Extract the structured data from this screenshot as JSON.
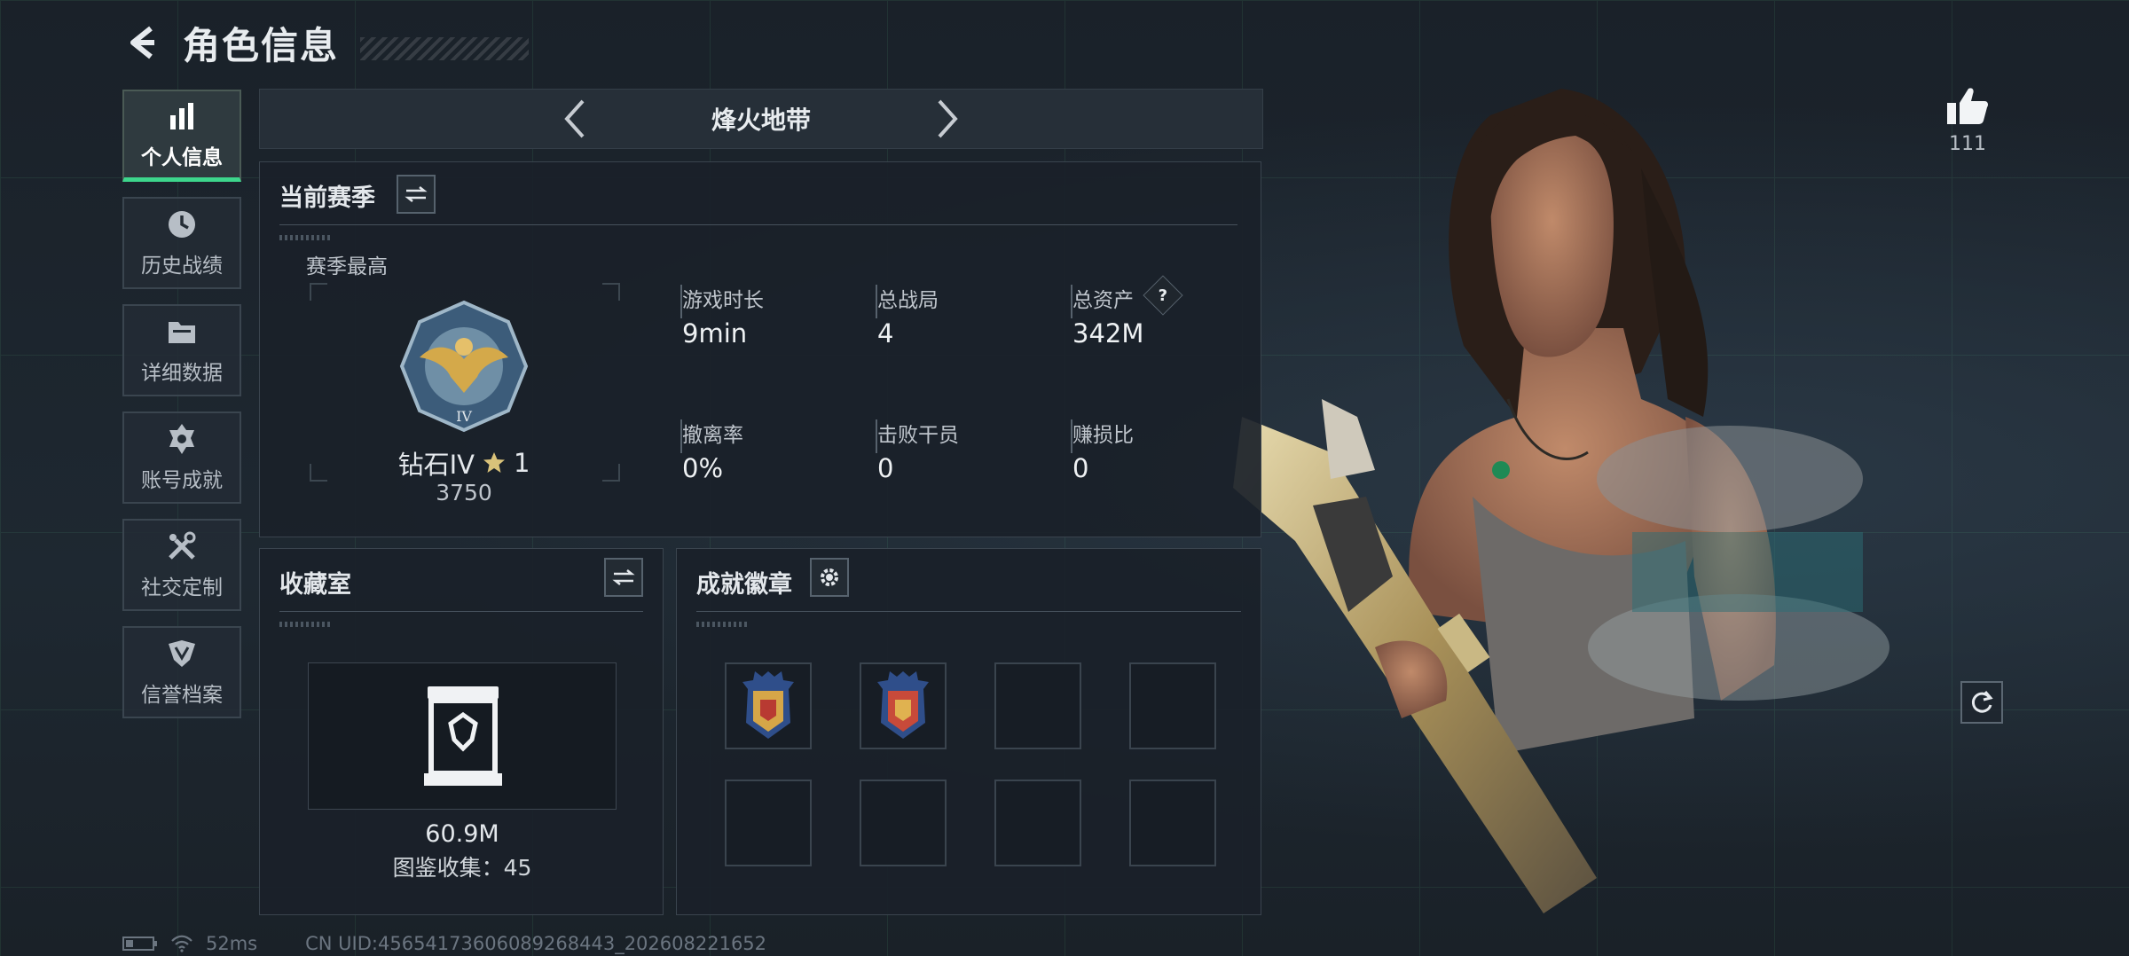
{
  "header": {
    "title": "角色信息"
  },
  "sidebar": {
    "items": [
      {
        "label": "个人信息",
        "icon": "bar-chart-icon",
        "active": true
      },
      {
        "label": "历史战绩",
        "icon": "clock-icon"
      },
      {
        "label": "详细数据",
        "icon": "folder-icon"
      },
      {
        "label": "账号成就",
        "icon": "badge-icon"
      },
      {
        "label": "社交定制",
        "icon": "tools-icon"
      },
      {
        "label": "信誉档案",
        "icon": "shield-icon"
      }
    ]
  },
  "map_selector": {
    "name": "烽火地带"
  },
  "season": {
    "title": "当前赛季",
    "best_label": "赛季最高",
    "rank_name": "钻石IV",
    "rank_stars": "1",
    "rank_score": "3750",
    "stats": [
      {
        "label": "游戏时长",
        "value": "9min"
      },
      {
        "label": "总战局",
        "value": "4"
      },
      {
        "label": "总资产",
        "value": "342M",
        "help": "?"
      },
      {
        "label": "撤离率",
        "value": "0%"
      },
      {
        "label": "击败干员",
        "value": "0"
      },
      {
        "label": "赚损比",
        "value": "0"
      }
    ]
  },
  "collection": {
    "title": "收藏室",
    "value": "60.9M",
    "catalog": "图鉴收集：45"
  },
  "achievements": {
    "title": "成就徽章"
  },
  "likes": {
    "count": "111"
  },
  "status": {
    "ping": "52ms",
    "uid": "CN UID:456541736060892684​43_202608221652"
  },
  "colors": {
    "accent": "#3dd68c",
    "background": "#1b232c"
  }
}
